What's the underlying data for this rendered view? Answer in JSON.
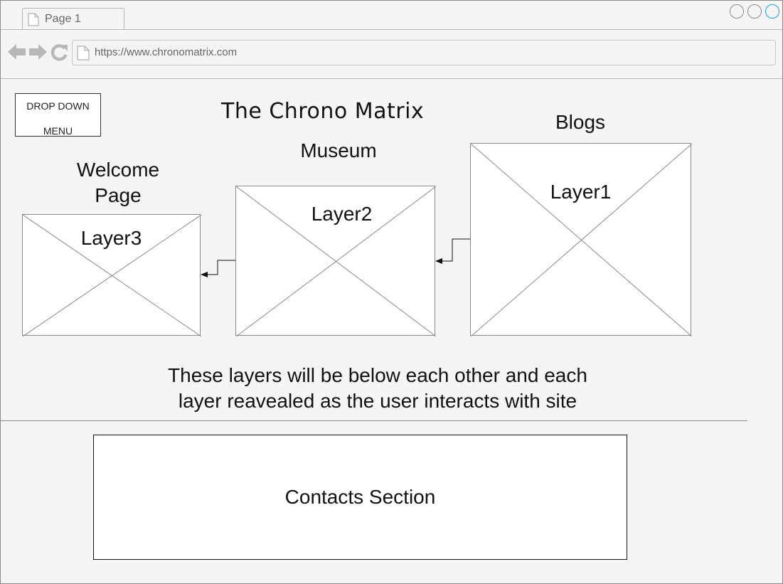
{
  "browser": {
    "tab_label": "Page 1",
    "url": "https://www.chronomatrix.com",
    "icons": [
      "page-icon",
      "back-arrow-icon",
      "forward-arrow-icon",
      "refresh-icon"
    ]
  },
  "page": {
    "dropdown": {
      "line1": "DROP DOWN",
      "line2": "MENU"
    },
    "title": "The Chrono Matrix",
    "sections": [
      {
        "name_line1": "Welcome",
        "name_line2": "Page",
        "layer": "Layer3"
      },
      {
        "name_line1": "Museum",
        "layer": "Layer2"
      },
      {
        "name_line1": "Blogs",
        "layer": "Layer1"
      }
    ],
    "note_line1": "These layers will be below each other and each",
    "note_line2": "layer reavealed as the user interacts with site",
    "contacts": "Contacts Section"
  },
  "colors": {
    "accent": "#1ba1e2",
    "frame_bg": "#f5f5f5",
    "border": "#8a8a8a"
  }
}
